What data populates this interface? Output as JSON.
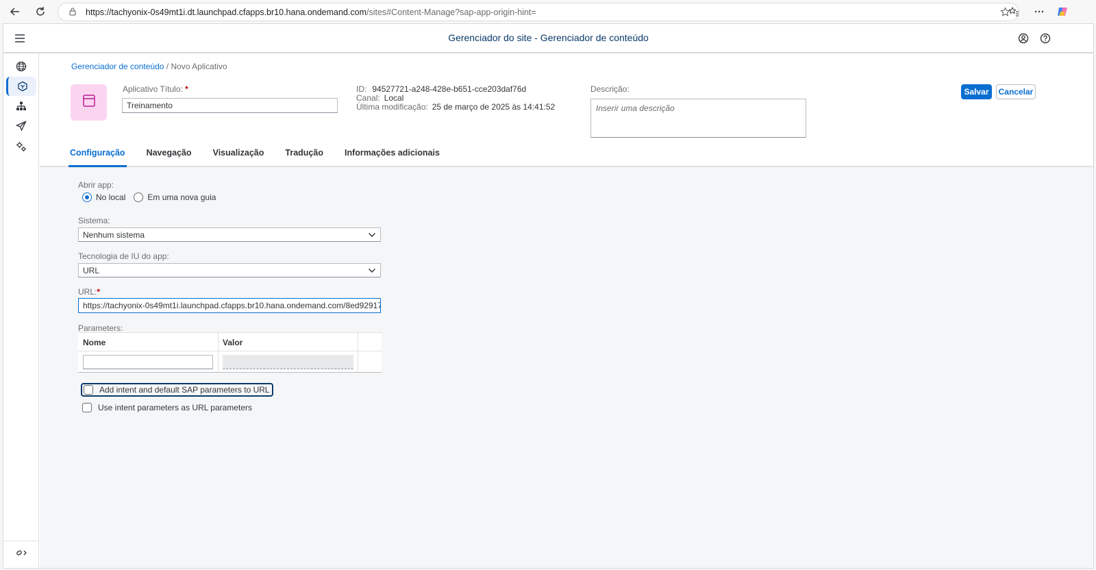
{
  "browser": {
    "url_host": "https://tachyonix-0s49mt1i.dt.launchpad.cfapps.br10.hana.ondemand.com",
    "url_path": "/sites#Content-Manage?sap-app-origin-hint="
  },
  "shell": {
    "title": "Gerenciador do site - Gerenciador de conteúdo"
  },
  "breadcrumb": {
    "link": "Gerenciador de conteúdo",
    "current": "/ Novo Aplicativo"
  },
  "header": {
    "title_label": "Aplicativo Título:",
    "required_mark": "*",
    "title_value": "Treinamento",
    "id_label": "ID:",
    "id_value": "94527721-a248-428e-b651-cce203daf76d",
    "channel_label": "Canal:",
    "channel_value": "Local",
    "modified_label": "Última modificação:",
    "modified_value": "25 de março de 2025 às 14:41:52",
    "description_label": "Descrição:",
    "description_placeholder": "Inserir uma descrição",
    "save_label": "Salvar",
    "cancel_label": "Cancelar"
  },
  "tabs": [
    {
      "label": "Configuração",
      "active": true
    },
    {
      "label": "Navegação",
      "active": false
    },
    {
      "label": "Visualização",
      "active": false
    },
    {
      "label": "Tradução",
      "active": false
    },
    {
      "label": "Informações adicionais",
      "active": false
    }
  ],
  "form": {
    "open_app_label": "Abrir app:",
    "open_app_options": [
      "No local",
      "Em uma nova guia"
    ],
    "open_app_selected": "No local",
    "system_label": "Sistema:",
    "system_value": "Nenhum sistema",
    "ui_tech_label": "Tecnologia de IU do app:",
    "ui_tech_value": "URL",
    "url_label": "URL:",
    "url_value": "https://tachyonix-0s49mt1i.launchpad.cfapps.br10.hana.ondemand.com/8ed92917...",
    "parameters_label": "Parameters:",
    "param_columns": [
      "Nome",
      "Valor"
    ],
    "checkbox_intent_default": "Add intent and default SAP parameters to URL",
    "checkbox_intent_params": "Use intent parameters as URL parameters"
  },
  "colors": {
    "accent": "#0a6ed1",
    "title_blue": "#0a3a6b",
    "tile_pink": "#fbd5f0",
    "tile_icon": "#c0399f",
    "required": "#bb0000"
  }
}
